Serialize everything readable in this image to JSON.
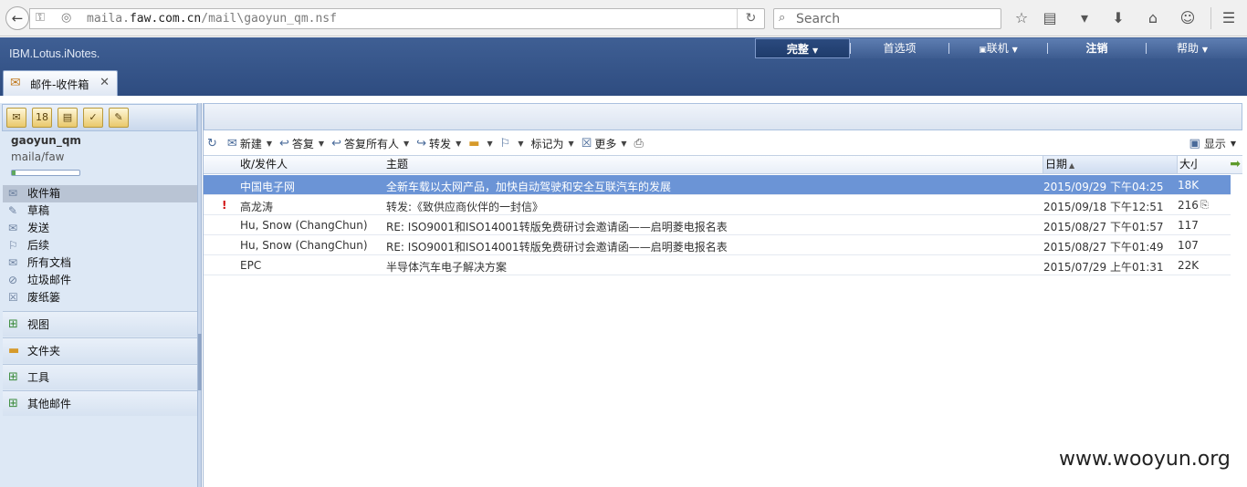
{
  "browser": {
    "back_icon": "back-arrow-icon",
    "url_prefix": "maila.",
    "url_domain": "faw.com.cn",
    "url_path": "/mail\\gaoyun_qm.nsf",
    "search_placeholder": "Search",
    "toolbar_icons": [
      "bookmark-star-icon",
      "reading-list-icon",
      "pocket-icon",
      "download-icon",
      "home-icon",
      "chat-icon",
      "menu-icon"
    ]
  },
  "notes": {
    "brand": "IBM.Lotus.iNotes.",
    "top_menu": [
      "完整",
      "首选项",
      "联机",
      "注销",
      "帮助"
    ],
    "tab_label": "邮件-收件箱",
    "tab_close": "✕"
  },
  "sidebar": {
    "user_name": "gaoyun_qm",
    "user_path": "maila/faw",
    "quota_fraction": 0.05,
    "folders": [
      "收件箱",
      "草稿",
      "发送",
      "后续",
      "所有文档",
      "垃圾邮件",
      "废纸篓"
    ],
    "groups": [
      "视图",
      "文件夹",
      "工具",
      "其他邮件"
    ]
  },
  "actions": {
    "new": "新建",
    "reply": "答复",
    "reply_all": "答复所有人",
    "forward": "转发",
    "mark_as": "标记为",
    "more": "更多",
    "display": "显示"
  },
  "columns": {
    "from": "收/发件人",
    "subject": "主题",
    "date": "日期",
    "size": "大小"
  },
  "messages": [
    {
      "priority": "",
      "from": "中国电子网",
      "subject": "全新车载以太网产品，加快自动驾驶和安全互联汽车的发展",
      "date": "2015/09/29 下午04:25",
      "size": "18K",
      "attachment": false,
      "selected": true
    },
    {
      "priority": "!",
      "from": "高龙涛",
      "subject": "转发:《致供应商伙伴的一封信》",
      "date": "2015/09/18 下午12:51",
      "size": "216",
      "attachment": true,
      "selected": false
    },
    {
      "priority": "",
      "from": "Hu, Snow (ChangChun)",
      "subject": "RE: ISO9001和ISO14001转版免费研讨会邀请函——启明菱电报名表",
      "date": "2015/08/27 下午01:57",
      "size": "117",
      "attachment": false,
      "selected": false
    },
    {
      "priority": "",
      "from": "Hu, Snow (ChangChun)",
      "subject": "RE: ISO9001和ISO14001转版免费研讨会邀请函——启明菱电报名表",
      "date": "2015/08/27 下午01:49",
      "size": "107",
      "attachment": false,
      "selected": false
    },
    {
      "priority": "",
      "from": "EPC",
      "subject": "半导体汽车电子解决方案",
      "date": "2015/07/29 上午01:31",
      "size": "22K",
      "attachment": false,
      "selected": false
    }
  ],
  "watermark": "www.wooyun.org"
}
